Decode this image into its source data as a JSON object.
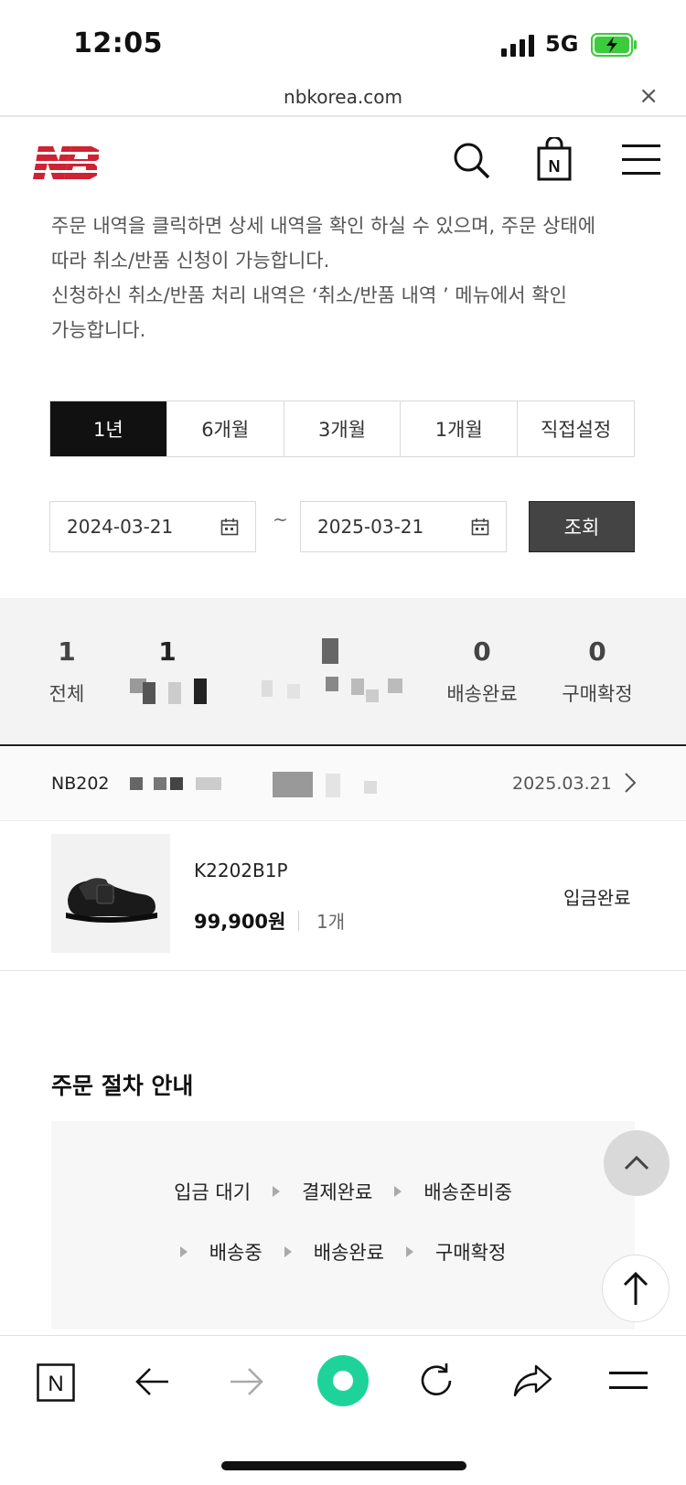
{
  "status_bar": {
    "time": "12:05",
    "network": "5G",
    "battery_color": "#3ccb3c"
  },
  "url_bar": {
    "domain": "nbkorea.com",
    "close_glyph": "×"
  },
  "header": {
    "logo_color": "#cf2232",
    "icons": [
      "search-icon",
      "shopping-bag-icon",
      "hamburger-menu-icon"
    ],
    "bag_letter": "N"
  },
  "notice": {
    "line1": "주문 내역을 클릭하면 상세 내역을 확인 하실 수 있으며, 주문 상태에",
    "line2": "따라 취소/반품 신청이 가능합니다.",
    "line3": "신청하신 취소/반품 처리 내역은 ‘취소/반품 내역 ’ 메뉴에서 확인",
    "line4": "가능합니다."
  },
  "period_tabs": [
    {
      "label": "1년",
      "active": true
    },
    {
      "label": "6개월",
      "active": false
    },
    {
      "label": "3개월",
      "active": false
    },
    {
      "label": "1개월",
      "active": false
    },
    {
      "label": "직접설정",
      "active": false
    }
  ],
  "date_range": {
    "start": "2024-03-21",
    "separator": "~",
    "end": "2025-03-21",
    "search_label": "조회"
  },
  "summary": [
    {
      "count": "1",
      "label": "전체"
    },
    {
      "count": "1",
      "label": ""
    },
    {
      "count": "",
      "label": ""
    },
    {
      "count": "0",
      "label": "배송완료"
    },
    {
      "count": "0",
      "label": "구매확정"
    }
  ],
  "order": {
    "number_prefix": "NB202",
    "date": "2025.03.21",
    "product_code": "K2202B1P",
    "price": "99,900원",
    "quantity": "1개",
    "status": "입금완료"
  },
  "guide": {
    "title": "주문 절차 안내",
    "row1": [
      "입금 대기",
      "결제완료",
      "배송준비중"
    ],
    "row2": [
      "배송중",
      "배송완료",
      "구매확정"
    ]
  },
  "bottom_bar": {
    "icons": [
      "naver-n-icon",
      "back-arrow-icon",
      "forward-arrow-icon",
      "green-home-icon",
      "refresh-icon",
      "share-icon",
      "menu-icon"
    ],
    "n_letter": "N",
    "accent": "#1ed39a"
  }
}
